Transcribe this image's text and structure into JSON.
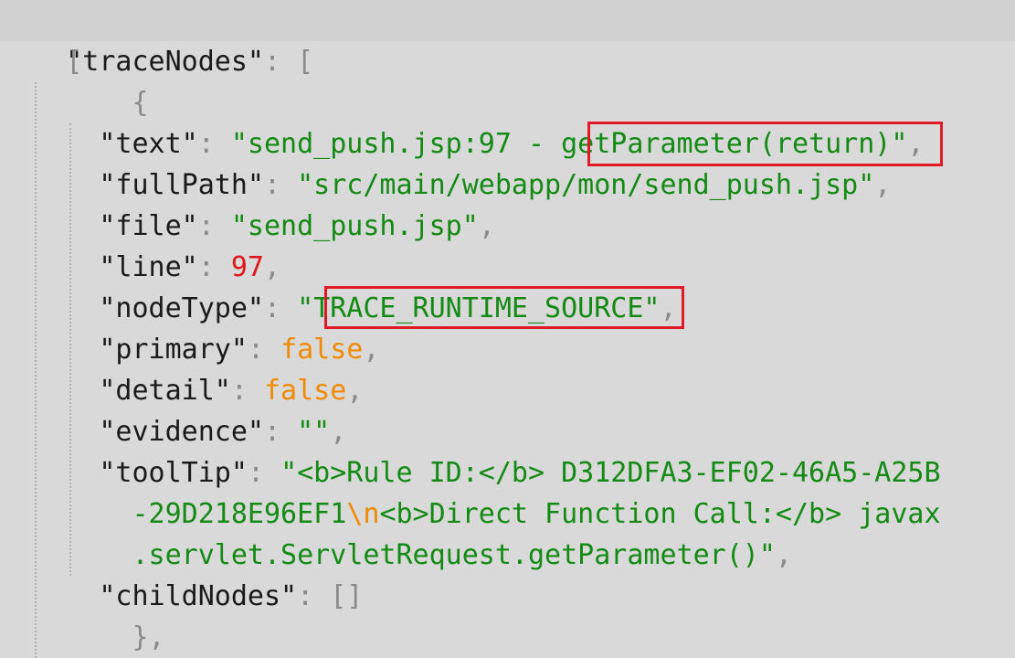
{
  "colors": {
    "background": "#d9d9d9",
    "key": "#1a1a1a",
    "punctuation": "#8a8a8a",
    "string": "#138a13",
    "number": "#e0161a",
    "boolean_and_escape": "#f08a00",
    "highlight_box": "#e11927"
  },
  "json": {
    "root_key": "\"traceNodes\"",
    "colon": ": ",
    "open_array": "[",
    "open_object": "{",
    "close_object": "},",
    "comma": ",",
    "text_key": "\"text\"",
    "text_value_prefix": "\"send_push.jsp:97 - ",
    "text_value_highlight": "getParameter(return)",
    "text_value_suffix": "\"",
    "fullPath_key": "\"fullPath\"",
    "fullPath_value": "\"src/main/webapp/mon/send_push.jsp\"",
    "file_key": "\"file\"",
    "file_value": "\"send_push.jsp\"",
    "line_key": "\"line\"",
    "line_value": "97",
    "nodeType_key": "\"nodeType\"",
    "nodeType_quote": "\"",
    "nodeType_value": "TRACE_RUNTIME_SOURCE",
    "primary_key": "\"primary\"",
    "primary_value": "false",
    "detail_key": "\"detail\"",
    "detail_value": "false",
    "evidence_key": "\"evidence\"",
    "evidence_value": "\"\"",
    "toolTip_key": "\"toolTip\"",
    "toolTip_line1": "\"<b>Rule ID:</b> D312DFA3-EF02-46A5-A25B",
    "toolTip_line2a": "-29D218E96EF1",
    "toolTip_escape": "\\n",
    "toolTip_line2b": "<b>Direct Function Call:</b> javax",
    "toolTip_line3": ".servlet.ServletRequest.getParameter()\"",
    "childNodes_key": "\"childNodes\"",
    "childNodes_value": "[]"
  }
}
